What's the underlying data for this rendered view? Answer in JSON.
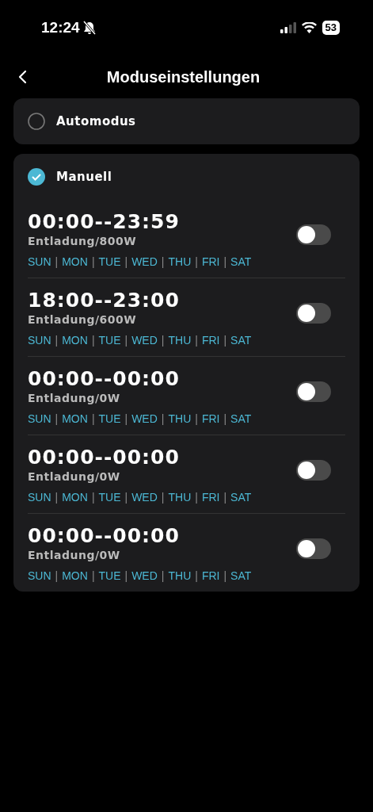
{
  "status_bar": {
    "time": "12:24",
    "battery": "53"
  },
  "nav": {
    "title": "Moduseinstellungen"
  },
  "modes": [
    {
      "label": "Automodus",
      "selected": false
    },
    {
      "label": "Manuell",
      "selected": true,
      "schedules": [
        {
          "time": "00:00--23:59",
          "power": "Entladung/800W",
          "on": false,
          "days": [
            {
              "kind": "day",
              "text": "SUN"
            },
            {
              "kind": "sep",
              "text": "|"
            },
            {
              "kind": "day",
              "text": "MON"
            },
            {
              "kind": "sep",
              "text": "|"
            },
            {
              "kind": "day",
              "text": "TUE"
            },
            {
              "kind": "sep",
              "text": "|"
            },
            {
              "kind": "day",
              "text": "WED"
            },
            {
              "kind": "sep",
              "text": "|"
            },
            {
              "kind": "day",
              "text": "THU"
            },
            {
              "kind": "sep",
              "text": "|"
            },
            {
              "kind": "day",
              "text": "FRI"
            },
            {
              "kind": "sep",
              "text": "|"
            },
            {
              "kind": "day",
              "text": "SAT"
            }
          ]
        },
        {
          "time": "18:00--23:00",
          "power": "Entladung/600W",
          "on": false,
          "days": [
            {
              "kind": "day",
              "text": "SUN"
            },
            {
              "kind": "sep",
              "text": "|"
            },
            {
              "kind": "day",
              "text": "MON"
            },
            {
              "kind": "sep",
              "text": "|"
            },
            {
              "kind": "day",
              "text": "TUE"
            },
            {
              "kind": "sep",
              "text": "|"
            },
            {
              "kind": "day",
              "text": "WED"
            },
            {
              "kind": "sep",
              "text": "|"
            },
            {
              "kind": "day",
              "text": "THU"
            },
            {
              "kind": "sep",
              "text": "|"
            },
            {
              "kind": "day",
              "text": "FRI"
            },
            {
              "kind": "sep",
              "text": "|"
            },
            {
              "kind": "day",
              "text": "SAT"
            }
          ]
        },
        {
          "time": "00:00--00:00",
          "power": "Entladung/0W",
          "on": false,
          "days": [
            {
              "kind": "day",
              "text": "SUN"
            },
            {
              "kind": "sep",
              "text": "|"
            },
            {
              "kind": "day",
              "text": "MON"
            },
            {
              "kind": "sep",
              "text": "|"
            },
            {
              "kind": "day",
              "text": "TUE"
            },
            {
              "kind": "sep",
              "text": "|"
            },
            {
              "kind": "day",
              "text": "WED"
            },
            {
              "kind": "sep",
              "text": "|"
            },
            {
              "kind": "day",
              "text": "THU"
            },
            {
              "kind": "sep",
              "text": "|"
            },
            {
              "kind": "day",
              "text": "FRI"
            },
            {
              "kind": "sep",
              "text": "|"
            },
            {
              "kind": "day",
              "text": "SAT"
            }
          ]
        },
        {
          "time": "00:00--00:00",
          "power": "Entladung/0W",
          "on": false,
          "days": [
            {
              "kind": "day",
              "text": "SUN"
            },
            {
              "kind": "sep",
              "text": "|"
            },
            {
              "kind": "day",
              "text": "MON"
            },
            {
              "kind": "sep",
              "text": "|"
            },
            {
              "kind": "day",
              "text": "TUE"
            },
            {
              "kind": "sep",
              "text": "|"
            },
            {
              "kind": "day",
              "text": "WED"
            },
            {
              "kind": "sep",
              "text": "|"
            },
            {
              "kind": "day",
              "text": "THU"
            },
            {
              "kind": "sep",
              "text": "|"
            },
            {
              "kind": "day",
              "text": "FRI"
            },
            {
              "kind": "sep",
              "text": "|"
            },
            {
              "kind": "day",
              "text": "SAT"
            }
          ]
        },
        {
          "time": "00:00--00:00",
          "power": "Entladung/0W",
          "on": false,
          "days": [
            {
              "kind": "day",
              "text": "SUN"
            },
            {
              "kind": "sep",
              "text": "|"
            },
            {
              "kind": "day",
              "text": "MON"
            },
            {
              "kind": "sep",
              "text": "|"
            },
            {
              "kind": "day",
              "text": "TUE"
            },
            {
              "kind": "sep",
              "text": "|"
            },
            {
              "kind": "day",
              "text": "WED"
            },
            {
              "kind": "sep",
              "text": "|"
            },
            {
              "kind": "day",
              "text": "THU"
            },
            {
              "kind": "sep",
              "text": "|"
            },
            {
              "kind": "day",
              "text": "FRI"
            },
            {
              "kind": "sep",
              "text": "|"
            },
            {
              "kind": "day",
              "text": "SAT"
            }
          ]
        }
      ]
    }
  ]
}
